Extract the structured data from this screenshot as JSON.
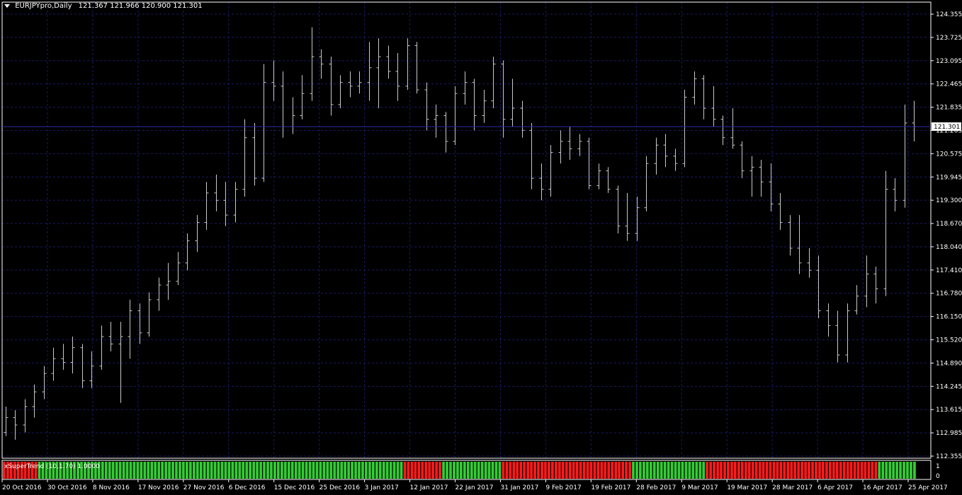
{
  "header": {
    "symbol": "EURJPYpro,Daily",
    "ohlc": "121.367 121.966 120.900 121.301"
  },
  "price_axis": {
    "labels": [
      "124.355",
      "123.725",
      "123.095",
      "122.465",
      "121.835",
      "121.205",
      "120.575",
      "119.945",
      "119.300",
      "118.670",
      "118.040",
      "117.410",
      "116.780",
      "116.150",
      "115.520",
      "114.890",
      "114.245",
      "113.615",
      "112.985",
      "112.355"
    ],
    "current_price": "121.301"
  },
  "time_axis": {
    "labels": [
      "20 Oct 2016",
      "30 Oct 2016",
      "8 Nov 2016",
      "17 Nov 2016",
      "27 Nov 2016",
      "6 Dec 2016",
      "15 Dec 2016",
      "25 Dec 2016",
      "3 Jan 2017",
      "12 Jan 2017",
      "22 Jan 2017",
      "31 Jan 2017",
      "9 Feb 2017",
      "19 Feb 2017",
      "28 Feb 2017",
      "9 Mar 2017",
      "19 Mar 2017",
      "28 Mar 2017",
      "6 Apr 2017",
      "16 Apr 2017",
      "25 Apr 2017"
    ]
  },
  "indicator": {
    "label": "xSuperTrend (10,1.70) 1.0000",
    "axis_labels": [
      "1",
      "0"
    ],
    "colors": {
      "up": "#33cc33",
      "down": "#ff1a1a"
    }
  },
  "colors": {
    "background": "#000000",
    "grid": "#1a1a66",
    "bars": "#c8c8c8",
    "axis": "#ffffff",
    "price_line": "#2a2aa0"
  },
  "chart_data": {
    "type": "ohlc",
    "title": "EURJPYpro,Daily",
    "ylim": [
      112.355,
      124.355
    ],
    "x_start": "19 Oct 2016",
    "x_end": "25 Apr 2017",
    "trend": [
      0,
      0,
      0,
      0,
      0,
      0,
      0,
      0,
      0,
      0,
      1,
      1,
      1,
      1,
      1,
      1,
      1,
      1,
      1,
      1,
      1,
      1,
      1,
      1,
      1,
      1,
      1,
      1,
      1,
      1,
      1,
      1,
      1,
      1,
      1,
      1,
      1,
      1,
      1,
      1,
      1,
      1,
      1,
      1,
      1,
      1,
      1,
      1,
      1,
      1,
      1,
      1,
      1,
      1,
      1,
      1,
      1,
      1,
      1,
      1,
      1,
      1,
      1,
      1,
      1,
      1,
      1,
      1,
      1,
      1,
      1,
      1,
      1,
      1,
      1,
      1,
      1,
      1,
      1,
      1,
      1,
      1,
      1,
      1,
      1,
      1,
      1,
      1,
      1,
      1,
      1,
      1,
      1,
      1,
      1,
      1,
      1,
      1,
      1,
      1,
      1,
      1,
      1,
      1,
      1,
      1,
      1,
      1,
      1,
      1,
      1,
      1,
      1,
      1,
      0,
      0,
      0,
      0,
      0,
      0,
      0,
      0,
      0,
      0,
      0,
      1,
      1,
      1,
      1,
      1,
      1,
      1,
      1,
      1,
      1,
      1,
      1,
      1,
      1,
      1,
      1,
      1,
      0,
      0,
      0,
      0,
      0,
      0,
      0,
      0,
      0,
      0,
      0,
      0,
      0,
      0,
      0,
      0,
      0,
      0,
      0,
      0,
      0,
      0,
      0,
      0,
      0,
      0,
      0,
      0,
      0,
      0,
      0,
      0,
      0,
      0,
      0,
      0,
      0,
      1,
      1,
      1,
      1,
      1,
      1,
      1,
      1,
      1,
      1,
      1,
      1,
      1,
      1,
      1,
      1,
      1,
      1,
      1,
      1,
      1,
      0,
      0,
      0,
      0,
      0,
      0,
      0,
      0,
      0,
      0,
      0,
      0,
      0,
      0,
      0,
      0,
      0,
      0,
      0,
      0,
      0,
      0,
      0,
      0,
      0,
      0,
      0,
      0,
      0,
      0,
      0,
      0,
      0,
      0,
      0,
      0,
      0,
      0,
      0,
      0,
      0,
      0,
      0,
      0,
      0,
      0,
      0,
      0,
      0,
      1,
      1,
      1,
      1,
      1,
      1,
      1,
      1,
      1,
      1,
      1
    ],
    "ohlc": [
      [
        113.0,
        113.7,
        112.9,
        113.4
      ],
      [
        113.4,
        113.6,
        112.8,
        113.2
      ],
      [
        113.2,
        113.9,
        113.0,
        113.7
      ],
      [
        113.7,
        114.3,
        113.4,
        114.1
      ],
      [
        114.1,
        114.8,
        113.9,
        114.6
      ],
      [
        114.6,
        115.3,
        114.4,
        115.0
      ],
      [
        115.0,
        115.4,
        114.7,
        114.9
      ],
      [
        114.9,
        115.6,
        114.6,
        115.3
      ],
      [
        115.3,
        115.4,
        114.2,
        114.4
      ],
      [
        114.4,
        115.2,
        114.2,
        114.8
      ],
      [
        114.8,
        115.9,
        114.7,
        115.6
      ],
      [
        115.6,
        116.0,
        115.2,
        115.4
      ],
      [
        115.4,
        116.0,
        113.8,
        115.6
      ],
      [
        115.6,
        116.6,
        115.0,
        116.3
      ],
      [
        116.3,
        116.5,
        115.4,
        115.7
      ],
      [
        115.7,
        116.8,
        115.6,
        116.6
      ],
      [
        116.6,
        117.2,
        116.3,
        117.0
      ],
      [
        117.0,
        117.6,
        116.6,
        117.1
      ],
      [
        117.1,
        117.9,
        117.0,
        117.6
      ],
      [
        117.6,
        118.4,
        117.4,
        118.2
      ],
      [
        118.2,
        118.9,
        117.9,
        118.7
      ],
      [
        118.7,
        119.8,
        118.5,
        119.5
      ],
      [
        119.5,
        120.0,
        119.0,
        119.3
      ],
      [
        119.3,
        119.8,
        118.6,
        118.9
      ],
      [
        118.9,
        119.8,
        118.7,
        119.6
      ],
      [
        119.6,
        121.5,
        119.4,
        121.0
      ],
      [
        121.0,
        121.4,
        119.7,
        119.9
      ],
      [
        119.9,
        123.0,
        119.8,
        122.5
      ],
      [
        122.5,
        123.1,
        122.0,
        122.4
      ],
      [
        122.4,
        122.8,
        121.0,
        121.3
      ],
      [
        121.3,
        122.1,
        121.1,
        121.6
      ],
      [
        121.6,
        122.7,
        121.5,
        122.2
      ],
      [
        122.2,
        124.0,
        122.0,
        123.2
      ],
      [
        123.2,
        123.4,
        122.6,
        123.0
      ],
      [
        123.0,
        123.2,
        121.6,
        121.9
      ],
      [
        121.9,
        122.7,
        121.8,
        122.5
      ],
      [
        122.5,
        122.8,
        122.1,
        122.4
      ],
      [
        122.4,
        122.8,
        122.2,
        122.5
      ],
      [
        122.5,
        123.6,
        122.0,
        122.9
      ],
      [
        122.9,
        123.7,
        121.8,
        123.2
      ],
      [
        123.2,
        123.5,
        122.6,
        122.8
      ],
      [
        122.8,
        123.3,
        122.0,
        122.4
      ],
      [
        122.4,
        123.7,
        122.3,
        123.5
      ],
      [
        123.5,
        123.6,
        122.2,
        122.3
      ],
      [
        122.3,
        122.5,
        121.2,
        121.5
      ],
      [
        121.5,
        121.9,
        121.0,
        121.6
      ],
      [
        121.6,
        121.7,
        120.6,
        120.9
      ],
      [
        120.9,
        122.4,
        120.8,
        122.2
      ],
      [
        122.2,
        122.8,
        121.9,
        122.5
      ],
      [
        122.5,
        122.6,
        121.2,
        121.6
      ],
      [
        121.6,
        122.3,
        121.4,
        122.0
      ],
      [
        122.0,
        123.2,
        121.8,
        123.0
      ],
      [
        123.0,
        123.1,
        121.0,
        121.5
      ],
      [
        121.5,
        122.6,
        121.3,
        121.8
      ],
      [
        121.8,
        122.0,
        121.0,
        121.2
      ],
      [
        121.2,
        121.4,
        119.6,
        119.9
      ],
      [
        119.9,
        120.3,
        119.3,
        119.6
      ],
      [
        119.6,
        120.8,
        119.4,
        120.6
      ],
      [
        120.6,
        121.2,
        120.3,
        120.9
      ],
      [
        120.9,
        121.3,
        120.4,
        120.7
      ],
      [
        120.7,
        121.1,
        120.5,
        120.9
      ],
      [
        120.9,
        121.0,
        119.6,
        119.7
      ],
      [
        119.7,
        120.3,
        119.6,
        120.1
      ],
      [
        120.1,
        120.2,
        119.5,
        119.6
      ],
      [
        119.6,
        119.7,
        118.4,
        118.6
      ],
      [
        118.6,
        119.5,
        118.2,
        118.4
      ],
      [
        118.4,
        119.4,
        118.2,
        119.1
      ],
      [
        119.1,
        120.5,
        119.0,
        120.3
      ],
      [
        120.3,
        121.0,
        120.0,
        120.8
      ],
      [
        120.8,
        121.1,
        120.2,
        120.5
      ],
      [
        120.5,
        120.7,
        120.1,
        120.3
      ],
      [
        120.3,
        122.3,
        120.2,
        122.1
      ],
      [
        122.1,
        122.8,
        121.9,
        122.6
      ],
      [
        122.6,
        122.7,
        121.5,
        121.8
      ],
      [
        121.8,
        122.4,
        121.3,
        121.5
      ],
      [
        121.5,
        121.6,
        120.8,
        121.0
      ],
      [
        121.0,
        121.8,
        120.7,
        120.8
      ],
      [
        120.8,
        120.9,
        119.9,
        120.1
      ],
      [
        120.1,
        120.5,
        119.4,
        120.2
      ],
      [
        120.2,
        120.4,
        119.4,
        119.8
      ],
      [
        119.8,
        120.3,
        119.0,
        119.2
      ],
      [
        119.2,
        119.5,
        118.5,
        118.7
      ],
      [
        118.7,
        118.9,
        117.8,
        118.0
      ],
      [
        118.0,
        118.9,
        117.3,
        117.6
      ],
      [
        117.6,
        118.0,
        117.2,
        117.4
      ],
      [
        117.4,
        117.8,
        116.1,
        116.3
      ],
      [
        116.3,
        116.5,
        115.6,
        115.9
      ],
      [
        115.9,
        116.3,
        114.9,
        115.1
      ],
      [
        115.1,
        116.5,
        114.9,
        116.3
      ],
      [
        116.3,
        117.0,
        116.2,
        116.7
      ],
      [
        116.7,
        117.8,
        116.4,
        117.3
      ],
      [
        117.3,
        117.5,
        116.5,
        116.9
      ],
      [
        116.9,
        120.1,
        116.7,
        119.6
      ],
      [
        119.6,
        119.9,
        119.0,
        119.3
      ],
      [
        119.3,
        121.9,
        119.1,
        121.4
      ],
      [
        121.4,
        122.0,
        120.9,
        121.3
      ]
    ]
  }
}
